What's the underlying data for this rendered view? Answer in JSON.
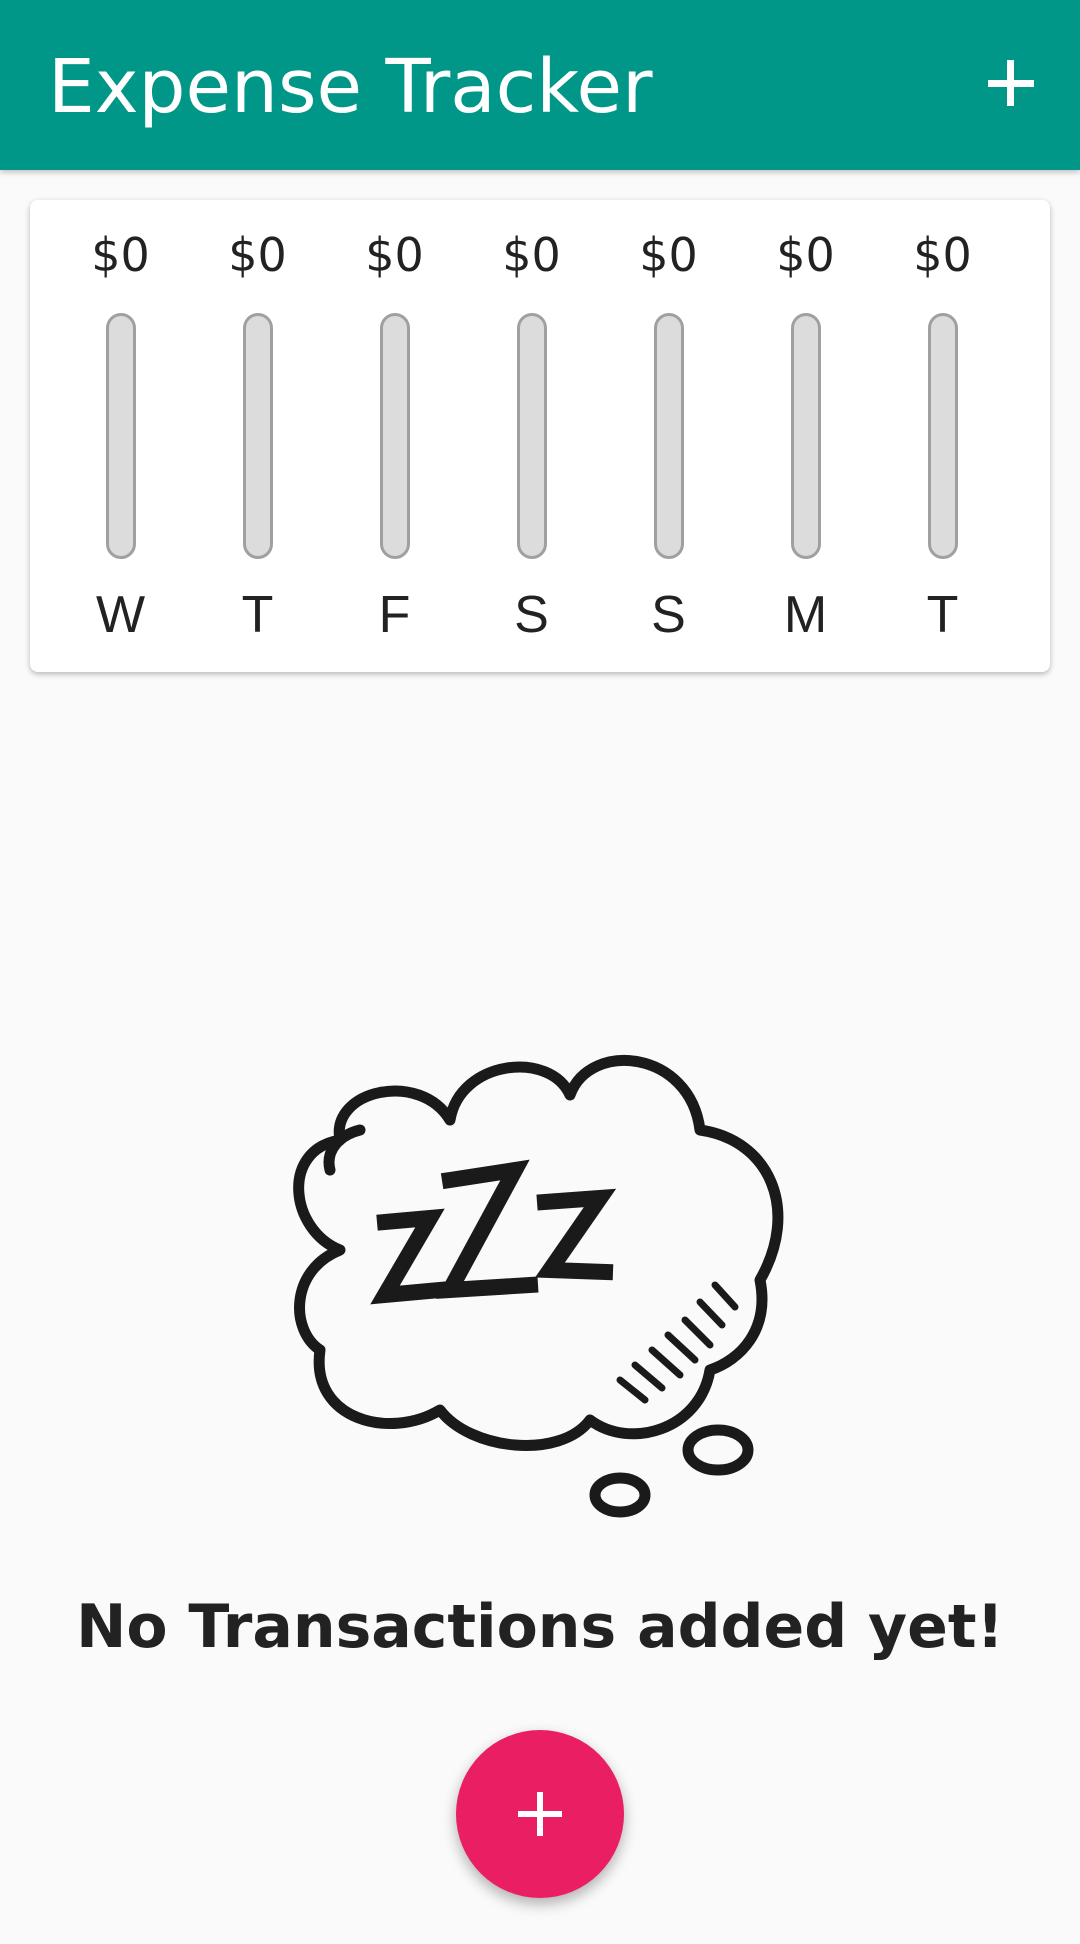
{
  "appbar": {
    "title": "Expense Tracker",
    "add_icon": "plus-icon",
    "color": "#009688"
  },
  "chart_data": {
    "type": "bar",
    "categories": [
      "W",
      "T",
      "F",
      "S",
      "S",
      "M",
      "T"
    ],
    "labels": [
      "$0",
      "$0",
      "$0",
      "$0",
      "$0",
      "$0",
      "$0"
    ],
    "values": [
      0,
      0,
      0,
      0,
      0,
      0,
      0
    ],
    "ylim": [
      0,
      1
    ],
    "title": "",
    "xlabel": "",
    "ylabel": "",
    "fill_color": "#e91e63",
    "track_color": "#dcdcdc"
  },
  "empty_state": {
    "illustration": "zzz-sleep-bubble-icon",
    "message": "No Transactions added yet!"
  },
  "fab": {
    "icon": "plus-icon",
    "color": "#e91e63"
  }
}
